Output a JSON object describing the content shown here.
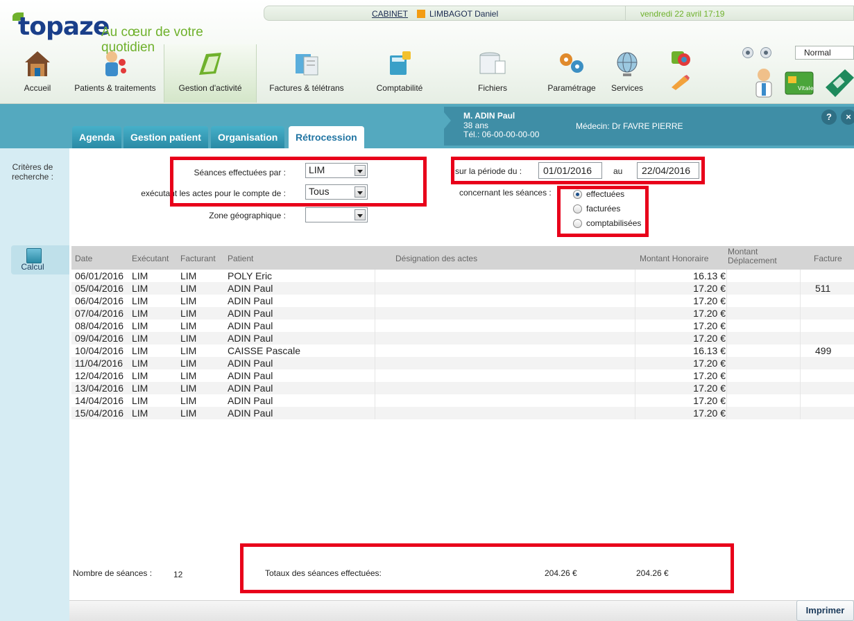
{
  "header": {
    "brand": "topaze",
    "slogan": "Au cœur de votre quotidien",
    "cabinet": "CABINET",
    "user": "LIMBAGOT Daniel",
    "datetime": "vendredi 22 avril 17:19",
    "user_color": "#f39c12",
    "zoom_value": "Normal"
  },
  "nav": [
    {
      "label": "Accueil",
      "icon": "home-icon"
    },
    {
      "label": "Patients & traitements",
      "icon": "patients-icon"
    },
    {
      "label": "Gestion d'activité",
      "icon": "activity-icon",
      "active": true
    },
    {
      "label": "Factures & télétrans",
      "icon": "invoice-icon"
    },
    {
      "label": "Comptabilité",
      "icon": "accounting-icon"
    },
    {
      "label": "Fichiers",
      "icon": "files-icon"
    },
    {
      "label": "Paramétrage",
      "icon": "settings-icon"
    },
    {
      "label": "Services",
      "icon": "globe-icon"
    }
  ],
  "tabs": [
    "Agenda",
    "Gestion patient",
    "Organisation",
    "Rétrocession"
  ],
  "active_tab": "Rétrocession",
  "patient": {
    "name": "M. ADIN Paul",
    "age": "38 ans",
    "tel": "Tél.: 06-00-00-00-00",
    "medecin": "Médecin: Dr FAVRE PIERRE"
  },
  "sidebar": {
    "criteria": "Critères de recherche :",
    "calc": "Calcul"
  },
  "criteria": {
    "seances_label": "Séances effectuées par :",
    "seances_value": "LIM",
    "compte_label": "exécutant les actes pour le compte de :",
    "compte_value": "Tous",
    "zone_label": "Zone géographique :",
    "zone_value": "",
    "periode_label": "sur la période du :",
    "date_from": "01/01/2016",
    "au_label": "au",
    "date_to": "22/04/2016",
    "concernant_label": "concernant les séances :",
    "radio": [
      {
        "label": "effectuées",
        "checked": true
      },
      {
        "label": "facturées",
        "checked": false
      },
      {
        "label": "comptabilisées",
        "checked": false
      }
    ]
  },
  "table": {
    "headers": [
      "Date",
      "Exécutant",
      "Facturant",
      "Patient",
      "Désignation des actes",
      "Montant Honoraire",
      "Montant Déplacement",
      "Facture"
    ],
    "rows": [
      [
        "06/01/2016",
        "LIM",
        "LIM",
        "POLY Eric",
        "",
        "16.13 €",
        "",
        ""
      ],
      [
        "05/04/2016",
        "LIM",
        "LIM",
        "ADIN Paul",
        "",
        "17.20 €",
        "",
        "511"
      ],
      [
        "06/04/2016",
        "LIM",
        "LIM",
        "ADIN Paul",
        "",
        "17.20 €",
        "",
        ""
      ],
      [
        "07/04/2016",
        "LIM",
        "LIM",
        "ADIN Paul",
        "",
        "17.20 €",
        "",
        ""
      ],
      [
        "08/04/2016",
        "LIM",
        "LIM",
        "ADIN Paul",
        "",
        "17.20 €",
        "",
        ""
      ],
      [
        "09/04/2016",
        "LIM",
        "LIM",
        "ADIN Paul",
        "",
        "17.20 €",
        "",
        ""
      ],
      [
        "10/04/2016",
        "LIM",
        "LIM",
        "CAISSE Pascale",
        "",
        "16.13 €",
        "",
        "499"
      ],
      [
        "11/04/2016",
        "LIM",
        "LIM",
        "ADIN Paul",
        "",
        "17.20 €",
        "",
        ""
      ],
      [
        "12/04/2016",
        "LIM",
        "LIM",
        "ADIN Paul",
        "",
        "17.20 €",
        "",
        ""
      ],
      [
        "13/04/2016",
        "LIM",
        "LIM",
        "ADIN Paul",
        "",
        "17.20 €",
        "",
        ""
      ],
      [
        "14/04/2016",
        "LIM",
        "LIM",
        "ADIN Paul",
        "",
        "17.20 €",
        "",
        ""
      ],
      [
        "15/04/2016",
        "LIM",
        "LIM",
        "ADIN Paul",
        "",
        "17.20 €",
        "",
        ""
      ]
    ]
  },
  "footer": {
    "count_label": "Nombre de séances :",
    "count": "12",
    "total_label": "Totaux des séances effectuées:",
    "total_honoraire": "204.26 €",
    "total_deplacement": "204.26 €",
    "print": "Imprimer"
  }
}
